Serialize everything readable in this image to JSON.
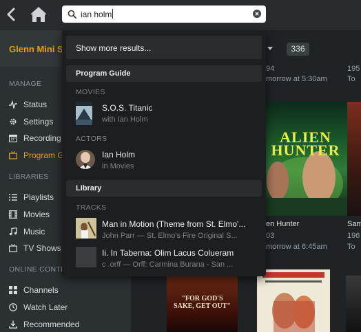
{
  "search": {
    "value": "ian holm"
  },
  "sidebar": {
    "server_name": "Glenn Mini S",
    "manage_label": "MANAGE",
    "manage_items": [
      {
        "label": "Status",
        "icon": "activity-icon"
      },
      {
        "label": "Settings",
        "icon": "gear-icon"
      },
      {
        "label": "Recording S",
        "icon": "calendar-icon"
      },
      {
        "label": "Program Gu",
        "icon": "tv-icon",
        "active": true
      }
    ],
    "libraries_label": "LIBRARIES",
    "library_items": [
      {
        "label": "Playlists",
        "icon": "list-icon"
      },
      {
        "label": "Movies",
        "icon": "film-icon"
      },
      {
        "label": "Music",
        "icon": "music-note-icon"
      },
      {
        "label": "TV Shows",
        "icon": "tv-icon"
      }
    ],
    "online_label": "ONLINE CONTEN",
    "online_items": [
      {
        "label": "Channels",
        "icon": "grid-icon"
      },
      {
        "label": "Watch Later",
        "icon": "clock-icon"
      },
      {
        "label": "Recommended",
        "icon": "download-icon"
      }
    ]
  },
  "content": {
    "count": "336",
    "top_left_snippet": "94",
    "top_right_snippet": "195",
    "airing_1": "morrow at 5:30am",
    "airing_1_right": "To",
    "movie_title": "en Hunter",
    "movie_title_right": "Sam",
    "movie_year": "03",
    "movie_year_right": "196",
    "airing_2": "morrow at 6:45am",
    "airing_2_right": "To",
    "poster_1_text": "ALIEN HUNTER",
    "poster_2_text": "\"FOR GOD'S SAKE, GET OUT\""
  },
  "dropdown": {
    "show_more": "Show more results...",
    "group_program_guide": "Program Guide",
    "cat_movies": "MOVIES",
    "movie_result": {
      "title": "S.O.S. Titanic",
      "subtitle": "with Ian Holm"
    },
    "cat_actors": "ACTORS",
    "actor_result": {
      "title": "Ian Holm",
      "subtitle": "in Movies"
    },
    "group_library": "Library",
    "cat_tracks": "TRACKS",
    "track_results": [
      {
        "title": "Man in Motion (Theme from St. Elmo'...",
        "subtitle": "John Parr — St. Elmo's Fire Original S..."
      },
      {
        "title": "Ii. In Taberna: Olim Lacus Colueram",
        "subtitle": "c .orff — Orff: Carmina Burana - San ..."
      }
    ]
  },
  "colors": {
    "accent": "#e5a00d",
    "background": "#1f2326",
    "dropdown": "#1c1e20"
  }
}
